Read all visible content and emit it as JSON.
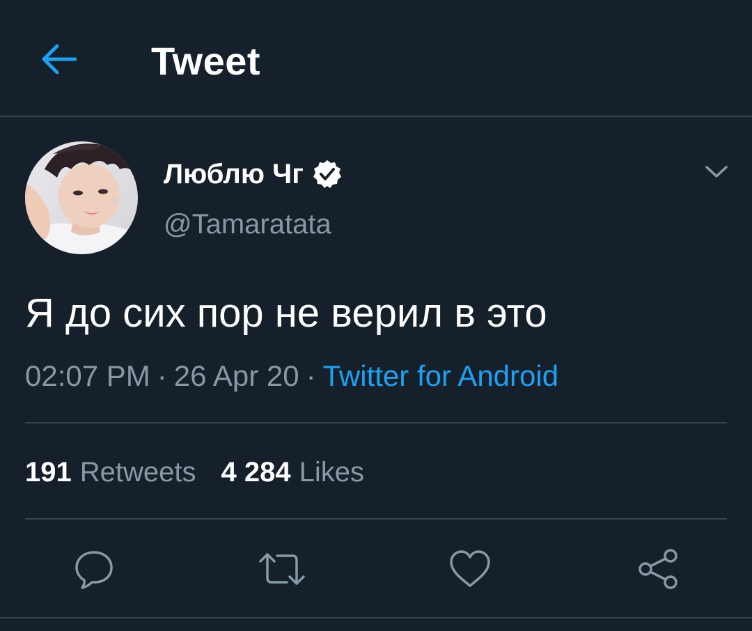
{
  "header": {
    "title": "Tweet",
    "back_icon": "arrow-left-icon"
  },
  "author": {
    "display_name": "Люблю Чг",
    "handle": "@Tamaratata",
    "verified": true
  },
  "tweet": {
    "text": "Я до сих пор не верил в это",
    "time": "02:07 PM",
    "date": "26 Apr 20",
    "source": "Twitter for Android"
  },
  "stats": {
    "retweets_count": "191",
    "retweets_label": "Retweets",
    "likes_count": "4 284",
    "likes_label": "Likes"
  },
  "actions": [
    {
      "icon": "reply-icon"
    },
    {
      "icon": "retweet-icon"
    },
    {
      "icon": "like-icon"
    },
    {
      "icon": "share-icon"
    }
  ],
  "colors": {
    "background": "#15202b",
    "accent": "#1da1f2",
    "secondary_text": "#8899a6",
    "divider": "#38444d"
  }
}
